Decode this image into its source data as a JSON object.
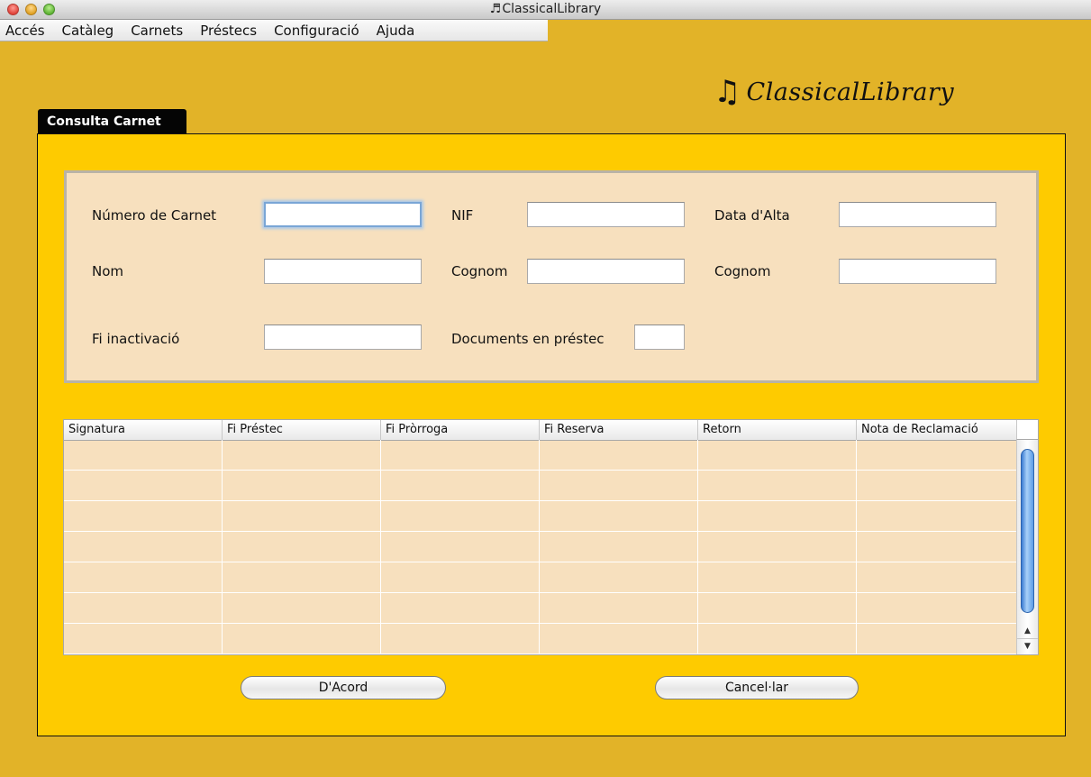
{
  "window": {
    "title": "ClassicalLibrary",
    "title_icon": "musical-note-icon"
  },
  "menubar": {
    "items": [
      "Accés",
      "Catàleg",
      "Carnets",
      "Préstecs",
      "Configuració",
      "Ajuda"
    ]
  },
  "logo": {
    "text": "ClassicalLibrary",
    "icon": "musical-note-icon"
  },
  "tab": {
    "label": "Consulta Carnet"
  },
  "form": {
    "numero_carnet": {
      "label": "Número de Carnet",
      "value": ""
    },
    "nif": {
      "label": "NIF",
      "value": ""
    },
    "data_alta": {
      "label": "Data d'Alta",
      "value": ""
    },
    "nom": {
      "label": "Nom",
      "value": ""
    },
    "cognom1": {
      "label": "Cognom",
      "value": ""
    },
    "cognom2": {
      "label": "Cognom",
      "value": ""
    },
    "fi_inactivacio": {
      "label": "Fi inactivació",
      "value": ""
    },
    "documents_prestec": {
      "label": "Documents en préstec",
      "value": ""
    }
  },
  "table": {
    "columns": [
      "Signatura",
      "Fi Préstec",
      "Fi Pròrroga",
      "Fi Reserva",
      "Retorn",
      "Nota de Reclamació"
    ],
    "rows": [
      [
        "",
        "",
        "",
        "",
        "",
        ""
      ],
      [
        "",
        "",
        "",
        "",
        "",
        ""
      ],
      [
        "",
        "",
        "",
        "",
        "",
        ""
      ],
      [
        "",
        "",
        "",
        "",
        "",
        ""
      ],
      [
        "",
        "",
        "",
        "",
        "",
        ""
      ],
      [
        "",
        "",
        "",
        "",
        "",
        ""
      ],
      [
        "",
        "",
        "",
        "",
        "",
        ""
      ]
    ]
  },
  "buttons": {
    "ok": "D'Acord",
    "cancel": "Cancel·lar"
  },
  "colors": {
    "window_background": "#e2b328",
    "panel_background": "#fecb00",
    "form_background": "#f7e0be",
    "tab_background": "#050505"
  }
}
